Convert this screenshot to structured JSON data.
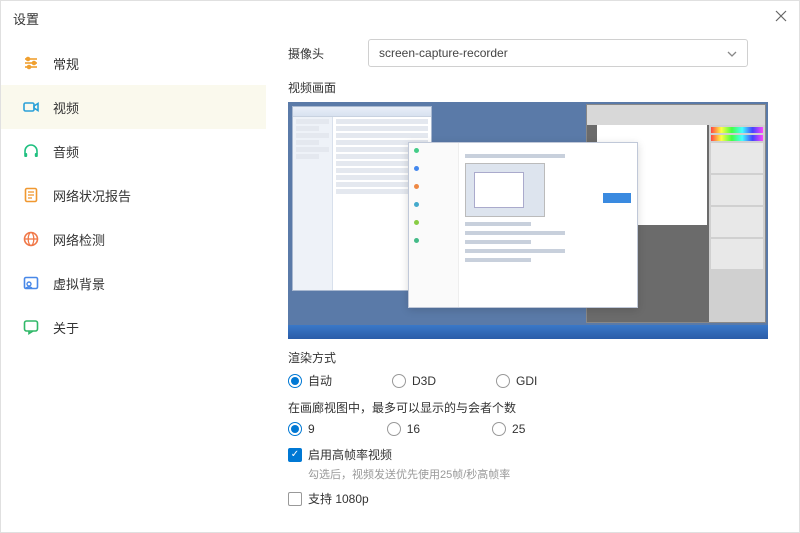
{
  "title": "设置",
  "nav": [
    {
      "label": "常规",
      "icon": "sliders",
      "color": "#f0a030"
    },
    {
      "label": "视频",
      "icon": "camera",
      "color": "#2aa0d8",
      "active": true
    },
    {
      "label": "音频",
      "icon": "headphones",
      "color": "#20c080"
    },
    {
      "label": "网络状况报告",
      "icon": "report",
      "color": "#f09830"
    },
    {
      "label": "网络检测",
      "icon": "globe",
      "color": "#f07848"
    },
    {
      "label": "虚拟背景",
      "icon": "background",
      "color": "#4888e8"
    },
    {
      "label": "关于",
      "icon": "about",
      "color": "#30b868"
    }
  ],
  "camera": {
    "label": "摄像头",
    "value": "screen-capture-recorder"
  },
  "preview_label": "视频画面",
  "render": {
    "label": "渲染方式",
    "options": [
      "自动",
      "D3D",
      "GDI"
    ],
    "selected": "自动"
  },
  "gallery": {
    "label": "在画廊视图中，最多可以显示的与会者个数",
    "options": [
      "9",
      "16",
      "25"
    ],
    "selected": "9"
  },
  "high_fps": {
    "label": "启用高帧率视频",
    "checked": true,
    "hint": "勾选后，视频发送优先使用25帧/秒高帧率"
  },
  "support_1080p": {
    "label": "支持 1080p",
    "checked": false
  }
}
